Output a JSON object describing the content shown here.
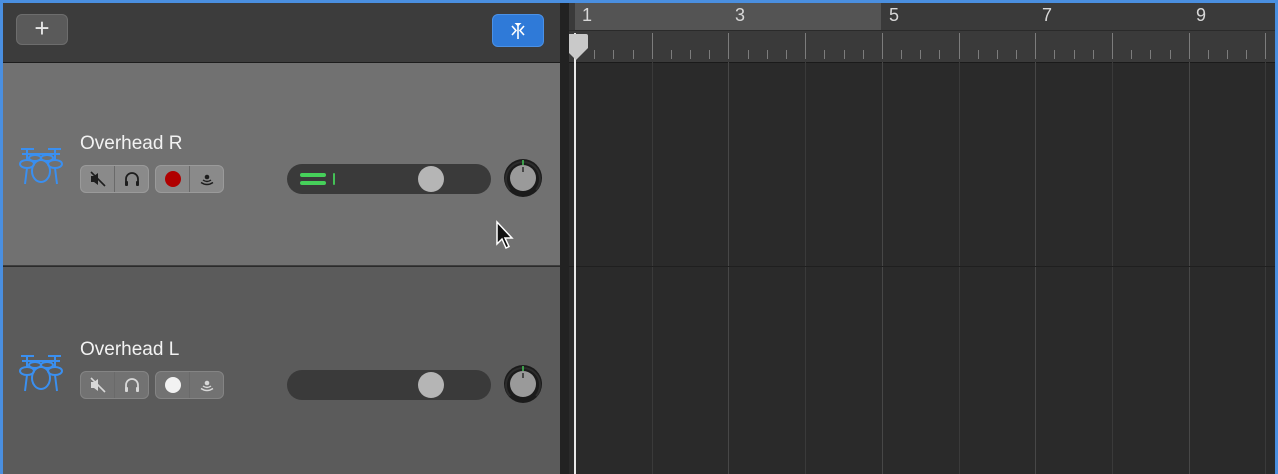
{
  "header": {
    "add_label": "+",
    "add_icon": "plus-icon",
    "filter_icon": "smart-controls-icon"
  },
  "tracks": [
    {
      "name": "Overhead R",
      "icon": "drum-kit-icon",
      "record_armed": true,
      "mute_icon": "mute-speaker-icon",
      "solo_icon": "headphones-icon",
      "input_icon": "input-monitor-icon",
      "volume_level": 0.7,
      "meter_active": true
    },
    {
      "name": "Overhead L",
      "icon": "drum-kit-icon",
      "record_armed": false,
      "mute_icon": "mute-speaker-icon",
      "solo_icon": "headphones-icon",
      "input_icon": "input-monitor-icon",
      "volume_level": 0.7,
      "meter_active": false
    }
  ],
  "ruler": {
    "bar_numbers": [
      "1",
      "3",
      "5",
      "7",
      "9"
    ]
  },
  "colors": {
    "accent": "#2f7ad8",
    "drum_icon": "#3a8ff0",
    "record_armed": "#b00000",
    "meter": "#46d05a"
  }
}
